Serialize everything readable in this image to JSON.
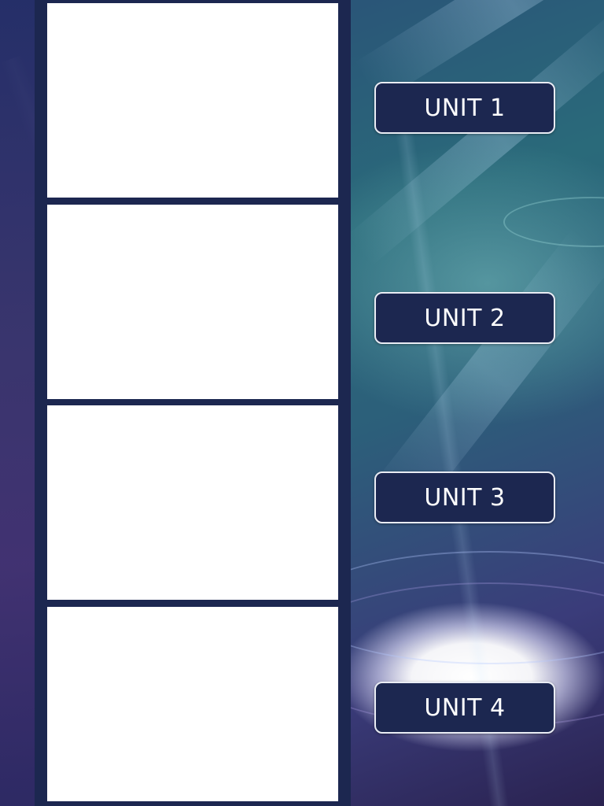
{
  "colors": {
    "panel": "#1c2750",
    "button_fill": "#1c2750",
    "button_border": "#e9ecf4",
    "card_fill": "#ffffff",
    "text": "#ffffff"
  },
  "units": [
    {
      "label": "UNIT 1"
    },
    {
      "label": "UNIT 2"
    },
    {
      "label": "UNIT 3"
    },
    {
      "label": "UNIT 4"
    }
  ]
}
